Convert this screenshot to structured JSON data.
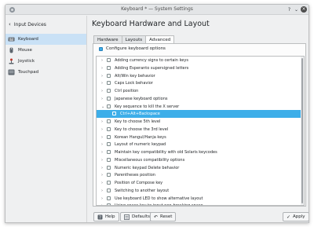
{
  "window": {
    "title": "Keyboard * — System Settings"
  },
  "sidebar": {
    "back_label": "Input Devices",
    "items": [
      {
        "label": "Keyboard",
        "icon": "keyboard-icon",
        "selected": true
      },
      {
        "label": "Mouse",
        "icon": "mouse-icon",
        "selected": false
      },
      {
        "label": "Joystick",
        "icon": "joystick-icon",
        "selected": false
      },
      {
        "label": "Touchpad",
        "icon": "touchpad-icon",
        "selected": false
      }
    ]
  },
  "main": {
    "heading": "Keyboard Hardware and Layout",
    "tabs": [
      {
        "label": "Hardware",
        "active": false
      },
      {
        "label": "Layouts",
        "active": false
      },
      {
        "label": "Advanced",
        "active": true
      }
    ],
    "configure_label": "Configure keyboard options",
    "options": [
      {
        "label": "Adding currency signs to certain keys",
        "expanded": false
      },
      {
        "label": "Adding Esperanto supersigned letters",
        "expanded": false
      },
      {
        "label": "Alt/Win key behavior",
        "expanded": false
      },
      {
        "label": "Caps Lock behavior",
        "expanded": false
      },
      {
        "label": "Ctrl position",
        "expanded": false
      },
      {
        "label": "Japanese keyboard options",
        "expanded": false
      },
      {
        "label": "Key sequence to kill the X server",
        "expanded": true
      },
      {
        "label": "Ctrl+Alt+Backspace",
        "child": true,
        "selected": true
      },
      {
        "label": "Key to choose 5th level",
        "expanded": false
      },
      {
        "label": "Key to choose the 3rd level",
        "expanded": false
      },
      {
        "label": "Korean Hangul/Hanja keys",
        "expanded": false
      },
      {
        "label": "Layout of numeric keypad",
        "expanded": false
      },
      {
        "label": "Maintain key compatibility with old Solaris keycodes",
        "expanded": false
      },
      {
        "label": "Miscellaneous compatibility options",
        "expanded": false
      },
      {
        "label": "Numeric keypad Delete behavior",
        "expanded": false
      },
      {
        "label": "Parentheses position",
        "expanded": false
      },
      {
        "label": "Position of Compose key",
        "expanded": false
      },
      {
        "label": "Switching to another layout",
        "expanded": false
      },
      {
        "label": "Use keyboard LED to show alternative layout",
        "expanded": false
      },
      {
        "label": "Using space key to input non-breaking space",
        "expanded": false
      }
    ]
  },
  "buttons": {
    "help": "Help",
    "defaults": "Defaults",
    "reset": "Reset",
    "apply": "Apply"
  },
  "colors": {
    "accent": "#3daee9",
    "selection_light": "#c9e1f6"
  }
}
